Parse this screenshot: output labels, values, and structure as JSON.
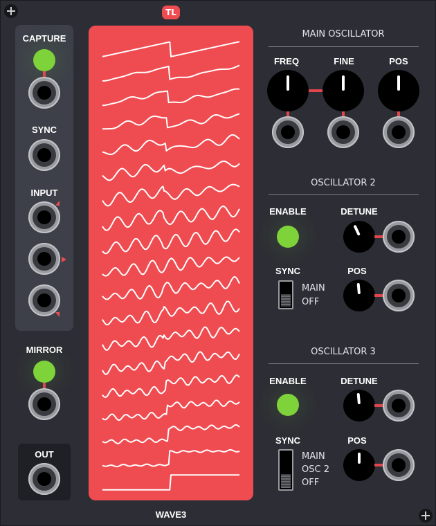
{
  "module": {
    "name": "WAVE3",
    "logo_text": "TL",
    "accent_color": "#ef4c51",
    "led_color": "#7fd33a",
    "background_color": "#2d2e35"
  },
  "left_panel": {
    "capture_label": "CAPTURE",
    "sync_label": "SYNC",
    "input_label": "INPUT",
    "mirror_label": "MIRROR",
    "out_label": "OUT"
  },
  "main_oscillator": {
    "title": "MAIN OSCILLATOR",
    "freq_label": "FREQ",
    "fine_label": "FINE",
    "pos_label": "POS"
  },
  "oscillator2": {
    "title": "OSCILLATOR 2",
    "enable_label": "ENABLE",
    "detune_label": "DETUNE",
    "sync_label": "SYNC",
    "pos_label": "POS",
    "sync_options": [
      "MAIN",
      "OFF"
    ],
    "sync_selected": "OFF"
  },
  "oscillator3": {
    "title": "OSCILLATOR 3",
    "enable_label": "ENABLE",
    "detune_label": "DETUNE",
    "sync_label": "SYNC",
    "pos_label": "POS",
    "sync_options": [
      "MAIN",
      "OSC 2",
      "OFF"
    ],
    "sync_selected": "OFF"
  },
  "wavetable": {
    "frame_count": 19,
    "description_icon": "wavetable-display"
  }
}
